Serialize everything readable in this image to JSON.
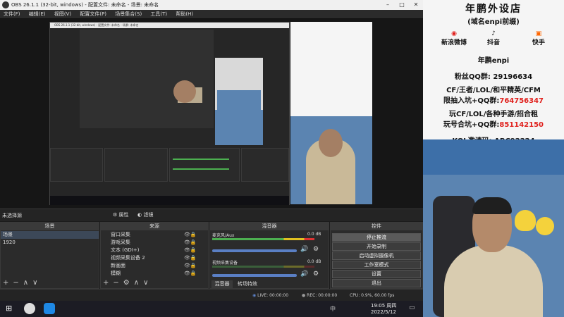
{
  "window": {
    "title": "OBS 26.1.1 (32-bit, windows) - 配置文件: 未命名 - 场景: 未命名"
  },
  "menu": [
    "文件(F)",
    "编辑(E)",
    "视图(V)",
    "配置文件(P)",
    "场景集合(S)",
    "工具(T)",
    "帮助(H)"
  ],
  "nested": {
    "title": "OBS 26.1.1 (32-bit, windows) - 配置文件: 未命名 - 场景: 未命名"
  },
  "filterbar": {
    "label": "未选择源",
    "properties": "属性",
    "filters": "滤镜"
  },
  "scenes": {
    "header": "场景",
    "items": [
      "场景",
      "1920"
    ]
  },
  "sources": {
    "header": "来源",
    "items": [
      "窗口采集",
      "游戏采集",
      "文本 (GDI+)",
      "视频采集设备 2",
      "新画面",
      "模糊"
    ]
  },
  "mixer": {
    "header": "混音器",
    "channels": [
      {
        "name": "麦克风/Aux",
        "level": "0.0 dB"
      },
      {
        "name": "视频采集设备",
        "level": "0.0 dB"
      }
    ],
    "tabs": [
      "混音器",
      "转场特效"
    ]
  },
  "controls": {
    "header": "控件",
    "buttons": [
      "停止推流",
      "开始录制",
      "启动虚拟摄像机",
      "工作室模式",
      "设置",
      "退出"
    ]
  },
  "status": {
    "live": "LIVE: 00:00:00",
    "rec": "REC: 00:00:00",
    "cpu": "CPU: 0.9%, 60.00 fps"
  },
  "taskbar": {
    "time": "19:05 周四",
    "date": "2022/5/12",
    "ime": "中"
  },
  "banner": {
    "title": "年鹏外设店",
    "subtitle": "(域名enpi前缀)",
    "socials": [
      "新浪微博",
      "抖音",
      "快手"
    ],
    "handle": "年鹏enpi",
    "fans_label": "粉丝QQ群:",
    "fans_number": "29196634",
    "games_line": "CF/王者/LOL/和平精英/CFM",
    "group1_label": "限抽入坑+QQ群:",
    "group1_number": "764756347",
    "games_line2": "玩CF/LOL/各种手游/招合租",
    "group2_label": "玩号合坑+QQ群:",
    "group2_number": "851142150",
    "kol_label": "KOL邀请码:",
    "kol_code": "ABC92224"
  },
  "colors": {
    "accent_red": "#e0201c",
    "obs_dark": "#2b2b2b",
    "selected_button": "#5a5a5a"
  }
}
